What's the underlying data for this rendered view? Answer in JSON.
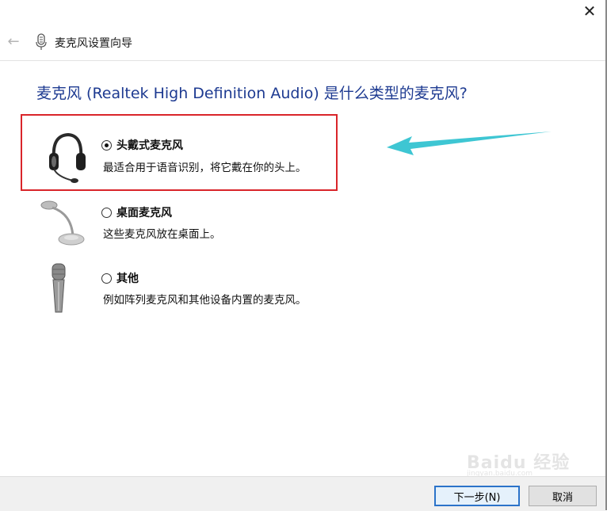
{
  "window": {
    "close_glyph": "✕",
    "title": "麦克风设置向导",
    "back_glyph": "←"
  },
  "main": {
    "question": "麦克风 (Realtek High Definition Audio) 是什么类型的麦克风?",
    "options": [
      {
        "label": "头戴式麦克风",
        "description": "最适合用于语音识别，将它戴在你的头上。",
        "selected": true,
        "icon": "headset-icon"
      },
      {
        "label": "桌面麦克风",
        "description": "这些麦克风放在桌面上。",
        "selected": false,
        "icon": "desk-microphone-icon"
      },
      {
        "label": "其他",
        "description": "例如阵列麦克风和其他设备内置的麦克风。",
        "selected": false,
        "icon": "handheld-microphone-icon"
      }
    ]
  },
  "footer": {
    "next_label": "下一步(N)",
    "cancel_label": "取消"
  },
  "watermark": {
    "text": "Baidu 经验",
    "sub": "jingyan.baidu.com"
  },
  "colors": {
    "question": "#1d3a91",
    "highlight": "#d9252a",
    "arrow": "#3ec6d3"
  }
}
